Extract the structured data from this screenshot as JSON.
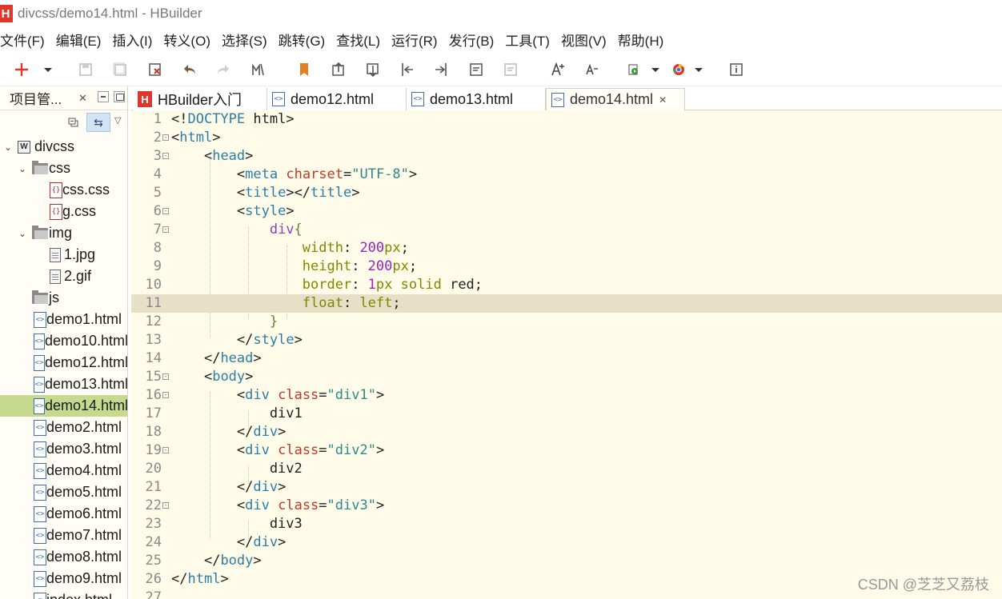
{
  "window": {
    "title": "divcss/demo14.html  -  HBuilder",
    "logo": "H"
  },
  "menu": [
    "文件(F)",
    "编辑(E)",
    "插入(I)",
    "转义(O)",
    "选择(S)",
    "跳转(G)",
    "查找(L)",
    "运行(R)",
    "发行(B)",
    "工具(T)",
    "视图(V)",
    "帮助(H)"
  ],
  "project_panel": {
    "title": "项目管...",
    "close": "✕"
  },
  "tree": [
    {
      "label": "divcss",
      "type": "project",
      "depth": 0,
      "expanded": true
    },
    {
      "label": "css",
      "type": "folder",
      "depth": 1,
      "expanded": true
    },
    {
      "label": "css.css",
      "type": "css",
      "depth": 2
    },
    {
      "label": "g.css",
      "type": "css",
      "depth": 2
    },
    {
      "label": "img",
      "type": "folder",
      "depth": 1,
      "expanded": true
    },
    {
      "label": "1.jpg",
      "type": "image",
      "depth": 2
    },
    {
      "label": "2.gif",
      "type": "image",
      "depth": 2
    },
    {
      "label": "js",
      "type": "folder",
      "depth": 1,
      "expanded": false
    },
    {
      "label": "demo1.html",
      "type": "html",
      "depth": 1
    },
    {
      "label": "demo10.html",
      "type": "html",
      "depth": 1
    },
    {
      "label": "demo12.html",
      "type": "html",
      "depth": 1
    },
    {
      "label": "demo13.html",
      "type": "html",
      "depth": 1
    },
    {
      "label": "demo14.html",
      "type": "html",
      "depth": 1,
      "selected": true
    },
    {
      "label": "demo2.html",
      "type": "html",
      "depth": 1
    },
    {
      "label": "demo3.html",
      "type": "html",
      "depth": 1
    },
    {
      "label": "demo4.html",
      "type": "html",
      "depth": 1
    },
    {
      "label": "demo5.html",
      "type": "html",
      "depth": 1
    },
    {
      "label": "demo6.html",
      "type": "html",
      "depth": 1
    },
    {
      "label": "demo7.html",
      "type": "html",
      "depth": 1
    },
    {
      "label": "demo8.html",
      "type": "html",
      "depth": 1
    },
    {
      "label": "demo9.html",
      "type": "html",
      "depth": 1
    },
    {
      "label": "index.html",
      "type": "html",
      "depth": 1
    }
  ],
  "tabs": [
    {
      "label": "HBuilder入门",
      "icon": "hbuilder-icon"
    },
    {
      "label": "demo12.html",
      "icon": "html-file-icon"
    },
    {
      "label": "demo13.html",
      "icon": "html-file-icon"
    },
    {
      "label": "demo14.html",
      "icon": "html-file-icon",
      "active": true,
      "close": "✕"
    }
  ],
  "editor": {
    "current_line": 11,
    "lines": [
      {
        "n": "1",
        "fold": "",
        "tokens": [
          [
            "t-bracket",
            "<!"
          ],
          [
            "t-tag",
            "DOCTYPE"
          ],
          [
            "t-plain",
            " html"
          ],
          [
            "t-bracket",
            ">"
          ]
        ]
      },
      {
        "n": "2",
        "fold": "-",
        "tokens": [
          [
            "t-bracket",
            "<"
          ],
          [
            "t-tag",
            "html"
          ],
          [
            "t-bracket",
            ">"
          ]
        ]
      },
      {
        "n": "3",
        "fold": "-",
        "tokens": [
          [
            "t-plain",
            "    "
          ],
          [
            "t-bracket",
            "<"
          ],
          [
            "t-tag",
            "head"
          ],
          [
            "t-bracket",
            ">"
          ]
        ]
      },
      {
        "n": "4",
        "fold": "",
        "tokens": [
          [
            "t-plain",
            "        "
          ],
          [
            "t-bracket",
            "<"
          ],
          [
            "t-tag",
            "meta"
          ],
          [
            "t-plain",
            " "
          ],
          [
            "t-attr",
            "charset"
          ],
          [
            "t-plain",
            "="
          ],
          [
            "t-str",
            "\"UTF-8\""
          ],
          [
            "t-bracket",
            ">"
          ]
        ]
      },
      {
        "n": "5",
        "fold": "",
        "tokens": [
          [
            "t-plain",
            "        "
          ],
          [
            "t-bracket",
            "<"
          ],
          [
            "t-tag",
            "title"
          ],
          [
            "t-bracket",
            "></"
          ],
          [
            "t-tag",
            "title"
          ],
          [
            "t-bracket",
            ">"
          ]
        ]
      },
      {
        "n": "6",
        "fold": "-",
        "tokens": [
          [
            "t-plain",
            "        "
          ],
          [
            "t-bracket",
            "<"
          ],
          [
            "t-tag",
            "style"
          ],
          [
            "t-bracket",
            ">"
          ]
        ]
      },
      {
        "n": "7",
        "fold": "-",
        "tokens": [
          [
            "t-plain",
            "            "
          ],
          [
            "t-sel",
            "div"
          ],
          [
            "t-brace",
            "{"
          ]
        ]
      },
      {
        "n": "8",
        "fold": "",
        "tokens": [
          [
            "t-plain",
            "                "
          ],
          [
            "t-prop",
            "width"
          ],
          [
            "t-plain",
            ": "
          ],
          [
            "t-num",
            "200"
          ],
          [
            "t-unit",
            "px"
          ],
          [
            "t-plain",
            ";"
          ]
        ]
      },
      {
        "n": "9",
        "fold": "",
        "tokens": [
          [
            "t-plain",
            "                "
          ],
          [
            "t-prop",
            "height"
          ],
          [
            "t-plain",
            ": "
          ],
          [
            "t-num",
            "200"
          ],
          [
            "t-unit",
            "px"
          ],
          [
            "t-plain",
            ";"
          ]
        ]
      },
      {
        "n": "10",
        "fold": "",
        "tokens": [
          [
            "t-plain",
            "                "
          ],
          [
            "t-prop",
            "border"
          ],
          [
            "t-plain",
            ": "
          ],
          [
            "t-num",
            "1"
          ],
          [
            "t-unit",
            "px"
          ],
          [
            "t-plain",
            " "
          ],
          [
            "t-kw",
            "solid"
          ],
          [
            "t-plain",
            " red;"
          ]
        ]
      },
      {
        "n": "11",
        "fold": "",
        "tokens": [
          [
            "t-plain",
            "                "
          ],
          [
            "t-prop",
            "float"
          ],
          [
            "t-plain",
            ": "
          ],
          [
            "t-kw",
            "left"
          ],
          [
            "t-plain",
            ";"
          ]
        ]
      },
      {
        "n": "12",
        "fold": "",
        "tokens": [
          [
            "t-plain",
            "            "
          ],
          [
            "t-brace",
            "}"
          ]
        ]
      },
      {
        "n": "13",
        "fold": "",
        "tokens": [
          [
            "t-plain",
            "        "
          ],
          [
            "t-bracket",
            "</"
          ],
          [
            "t-tag",
            "style"
          ],
          [
            "t-bracket",
            ">"
          ]
        ]
      },
      {
        "n": "14",
        "fold": "",
        "tokens": [
          [
            "t-plain",
            "    "
          ],
          [
            "t-bracket",
            "</"
          ],
          [
            "t-tag",
            "head"
          ],
          [
            "t-bracket",
            ">"
          ]
        ]
      },
      {
        "n": "15",
        "fold": "-",
        "tokens": [
          [
            "t-plain",
            "    "
          ],
          [
            "t-bracket",
            "<"
          ],
          [
            "t-tag",
            "body"
          ],
          [
            "t-bracket",
            ">"
          ]
        ]
      },
      {
        "n": "16",
        "fold": "-",
        "tokens": [
          [
            "t-plain",
            "        "
          ],
          [
            "t-bracket",
            "<"
          ],
          [
            "t-tag",
            "div"
          ],
          [
            "t-plain",
            " "
          ],
          [
            "t-attr",
            "class"
          ],
          [
            "t-plain",
            "="
          ],
          [
            "t-str",
            "\"div1\""
          ],
          [
            "t-bracket",
            ">"
          ]
        ]
      },
      {
        "n": "17",
        "fold": "",
        "tokens": [
          [
            "t-plain",
            "            div1"
          ]
        ]
      },
      {
        "n": "18",
        "fold": "",
        "tokens": [
          [
            "t-plain",
            "        "
          ],
          [
            "t-bracket",
            "</"
          ],
          [
            "t-tag",
            "div"
          ],
          [
            "t-bracket",
            ">"
          ]
        ]
      },
      {
        "n": "19",
        "fold": "-",
        "tokens": [
          [
            "t-plain",
            "        "
          ],
          [
            "t-bracket",
            "<"
          ],
          [
            "t-tag",
            "div"
          ],
          [
            "t-plain",
            " "
          ],
          [
            "t-attr",
            "class"
          ],
          [
            "t-plain",
            "="
          ],
          [
            "t-str",
            "\"div2\""
          ],
          [
            "t-bracket",
            ">"
          ]
        ]
      },
      {
        "n": "20",
        "fold": "",
        "tokens": [
          [
            "t-plain",
            "            div2"
          ]
        ]
      },
      {
        "n": "21",
        "fold": "",
        "tokens": [
          [
            "t-plain",
            "        "
          ],
          [
            "t-bracket",
            "</"
          ],
          [
            "t-tag",
            "div"
          ],
          [
            "t-bracket",
            ">"
          ]
        ]
      },
      {
        "n": "22",
        "fold": "-",
        "tokens": [
          [
            "t-plain",
            "        "
          ],
          [
            "t-bracket",
            "<"
          ],
          [
            "t-tag",
            "div"
          ],
          [
            "t-plain",
            " "
          ],
          [
            "t-attr",
            "class"
          ],
          [
            "t-plain",
            "="
          ],
          [
            "t-str",
            "\"div3\""
          ],
          [
            "t-bracket",
            ">"
          ]
        ]
      },
      {
        "n": "23",
        "fold": "",
        "tokens": [
          [
            "t-plain",
            "            div3"
          ]
        ]
      },
      {
        "n": "24",
        "fold": "",
        "tokens": [
          [
            "t-plain",
            "        "
          ],
          [
            "t-bracket",
            "</"
          ],
          [
            "t-tag",
            "div"
          ],
          [
            "t-bracket",
            ">"
          ]
        ]
      },
      {
        "n": "25",
        "fold": "",
        "tokens": [
          [
            "t-plain",
            "    "
          ],
          [
            "t-bracket",
            "</"
          ],
          [
            "t-tag",
            "body"
          ],
          [
            "t-bracket",
            ">"
          ]
        ]
      },
      {
        "n": "26",
        "fold": "",
        "tokens": [
          [
            "t-bracket",
            "</"
          ],
          [
            "t-tag",
            "html"
          ],
          [
            "t-bracket",
            ">"
          ]
        ]
      },
      {
        "n": "27",
        "fold": "",
        "tokens": []
      }
    ]
  },
  "watermark": "CSDN @芝芝又荔枝",
  "colors": {
    "brand": "#e0362b",
    "selection": "#c5d98f",
    "editor_bg": "#fefbe9",
    "current_line": "#e7dfc6"
  }
}
